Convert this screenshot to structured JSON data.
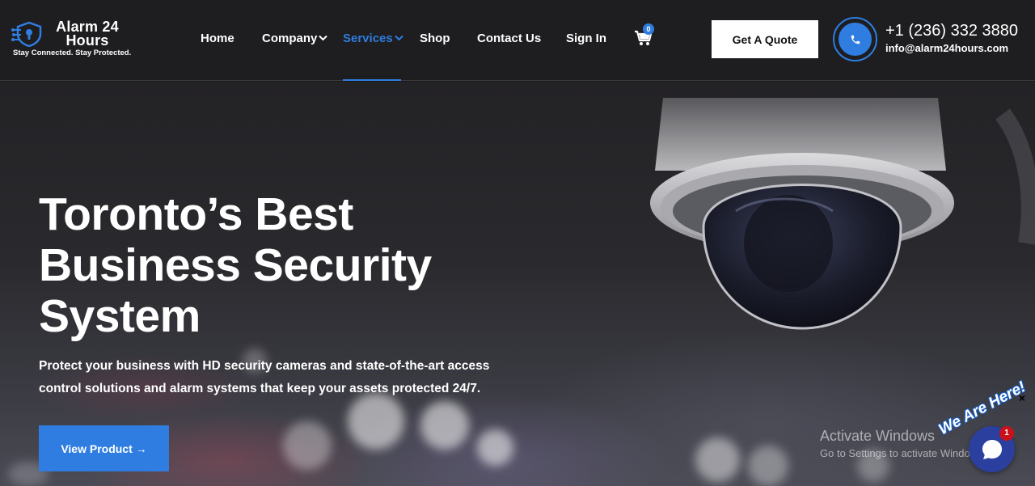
{
  "brand": {
    "name": "Alarm 24 Hours",
    "tagline": "Stay Connected. Stay Protected."
  },
  "nav": {
    "home": "Home",
    "company": "Company",
    "services": "Services",
    "shop": "Shop",
    "contact": "Contact Us",
    "signin": "Sign In",
    "active": "Services"
  },
  "cart": {
    "count": "0"
  },
  "quote_button": "Get A Quote",
  "contact": {
    "phone": "+1 (236) 332 3880",
    "email": "info@alarm24hours.com"
  },
  "hero": {
    "title": "Toronto’s Best\nBusiness Security\nSystem",
    "subtitle": "Protect your business with HD security cameras and state-of-the-art access control solutions and alarm systems that keep your assets protected 24/7.",
    "cta": "View Product →"
  },
  "windows_watermark": {
    "title": "Activate Windows",
    "subtitle": "Go to Settings to activate Windows."
  },
  "chat_widget": {
    "greeting": "We Are Here!",
    "badge": "1",
    "close": "×"
  },
  "colors": {
    "accent": "#2f7de1",
    "header_bg": "#1e1d1f",
    "chat_bg": "#2b3f9e",
    "badge_red": "#c9101b"
  },
  "icons": {
    "logo": "shield-network-icon",
    "cart": "shopping-cart-icon",
    "phone": "phone-icon",
    "chevron": "chevron-down-icon",
    "chat": "chat-bubble-icon"
  }
}
